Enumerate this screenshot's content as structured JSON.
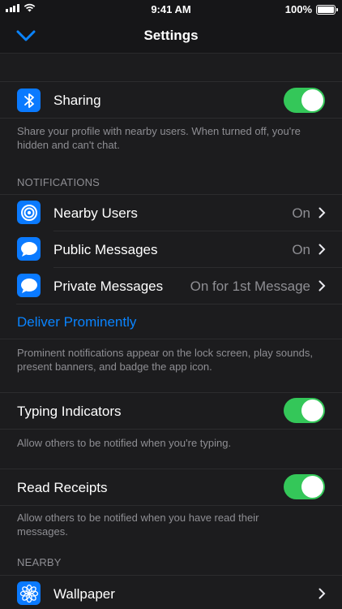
{
  "status_bar": {
    "time": "9:41 AM",
    "battery": "100%"
  },
  "nav": {
    "title": "Settings"
  },
  "sharing": {
    "label": "Sharing",
    "toggle_on": true,
    "footer": "Share your profile with nearby users. When turned off, you're hidden and can't chat."
  },
  "notifications": {
    "header": "NOTIFICATIONS",
    "items": [
      {
        "label": "Nearby Users",
        "value": "On",
        "icon": "target-icon"
      },
      {
        "label": "Public Messages",
        "value": "On",
        "icon": "chat-bubble-icon"
      },
      {
        "label": "Private Messages",
        "value": "On for 1st Message",
        "icon": "chat-bubble-icon"
      }
    ],
    "deliver_label": "Deliver Prominently",
    "footer": "Prominent notifications appear on the lock screen, play sounds, present banners, and badge the app icon."
  },
  "typing": {
    "label": "Typing Indicators",
    "toggle_on": true,
    "footer": "Allow others to be notified when you're typing."
  },
  "receipts": {
    "label": "Read Receipts",
    "toggle_on": true,
    "footer": "Allow others to be notified when you have read their messages."
  },
  "nearby": {
    "header": "NEARBY",
    "wallpaper_label": "Wallpaper"
  },
  "colors": {
    "accent": "#0a84ff",
    "toggle_on": "#34c759",
    "background": "#1c1c1e"
  }
}
